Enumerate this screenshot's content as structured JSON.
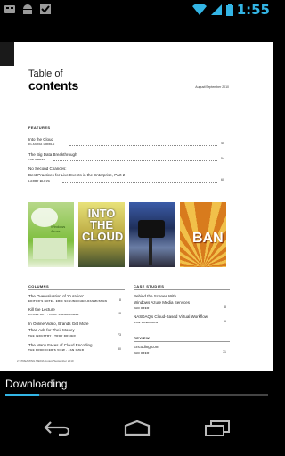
{
  "status": {
    "time": "1:55"
  },
  "page": {
    "title_line1": "Table of",
    "title_line2": "contents",
    "issue_date": "August/September 2010",
    "features_label": "FEATURES",
    "features": [
      {
        "title": "Into the Cloud",
        "author": "CLAUDIA HIDDLE",
        "page": "40"
      },
      {
        "title": "The Big Data Breakthrough",
        "author": "TIM GREEN",
        "page": "54"
      },
      {
        "title": "No Second Chances:",
        "title2": "Best Practices for Live Events in the Enterprise, Part 2",
        "author": "LARRY BLEVA",
        "page": "60"
      }
    ],
    "columns_label": "COLUMNS",
    "columns": [
      {
        "title": "The Overvaluation of ‘Curation’",
        "author": "EDITOR’S NOTE · ERIC SCHUMACHER-RASMUSSEN",
        "page": "8"
      },
      {
        "title": "Kill the Lecture",
        "author": "CLASS ACT · PAUL SIGNAMOREL",
        "page": "18"
      },
      {
        "title": "In Online Video, Brands Get More",
        "title2": "Than Ads for Their Money",
        "author": "THE INDUSTRY · TROY DREIER",
        "page": "73"
      },
      {
        "title": "The Many Faces of Cloud Encoding",
        "author": "THE PRODUCER’S VIEW · JAN OZER",
        "page": "80"
      }
    ],
    "case_label": "CASE STUDIES",
    "cases": [
      {
        "title": "Behind the Scenes With",
        "title2": "Windows Azure Media Services",
        "author": "JAN OZER",
        "page": "8"
      },
      {
        "title": "NASDAQ’s Cloud-Based Virtual Workflow",
        "author": "DON ROBINSON",
        "page": "9"
      }
    ],
    "review_label": "REVIEW",
    "reviews": [
      {
        "title": "Encoding.com",
        "author": "JAN OZER",
        "page": "71"
      }
    ],
    "covers": [
      {
        "text": "Windows Azure"
      },
      {
        "text": "INTO THE CLOUD"
      },
      {
        "text": ""
      },
      {
        "text": "BAN"
      }
    ],
    "footer": "2    STREAMING MEDIA August/September 2010"
  },
  "download": {
    "label": "Downloading"
  },
  "colors": {
    "accent": "#33b5e5",
    "statusbar": "#000000"
  },
  "icons": [
    "usb-icon",
    "android-icon",
    "check-icon",
    "wifi-icon",
    "signal-icon",
    "battery-icon",
    "back-icon",
    "home-icon",
    "recent-apps-icon"
  ]
}
